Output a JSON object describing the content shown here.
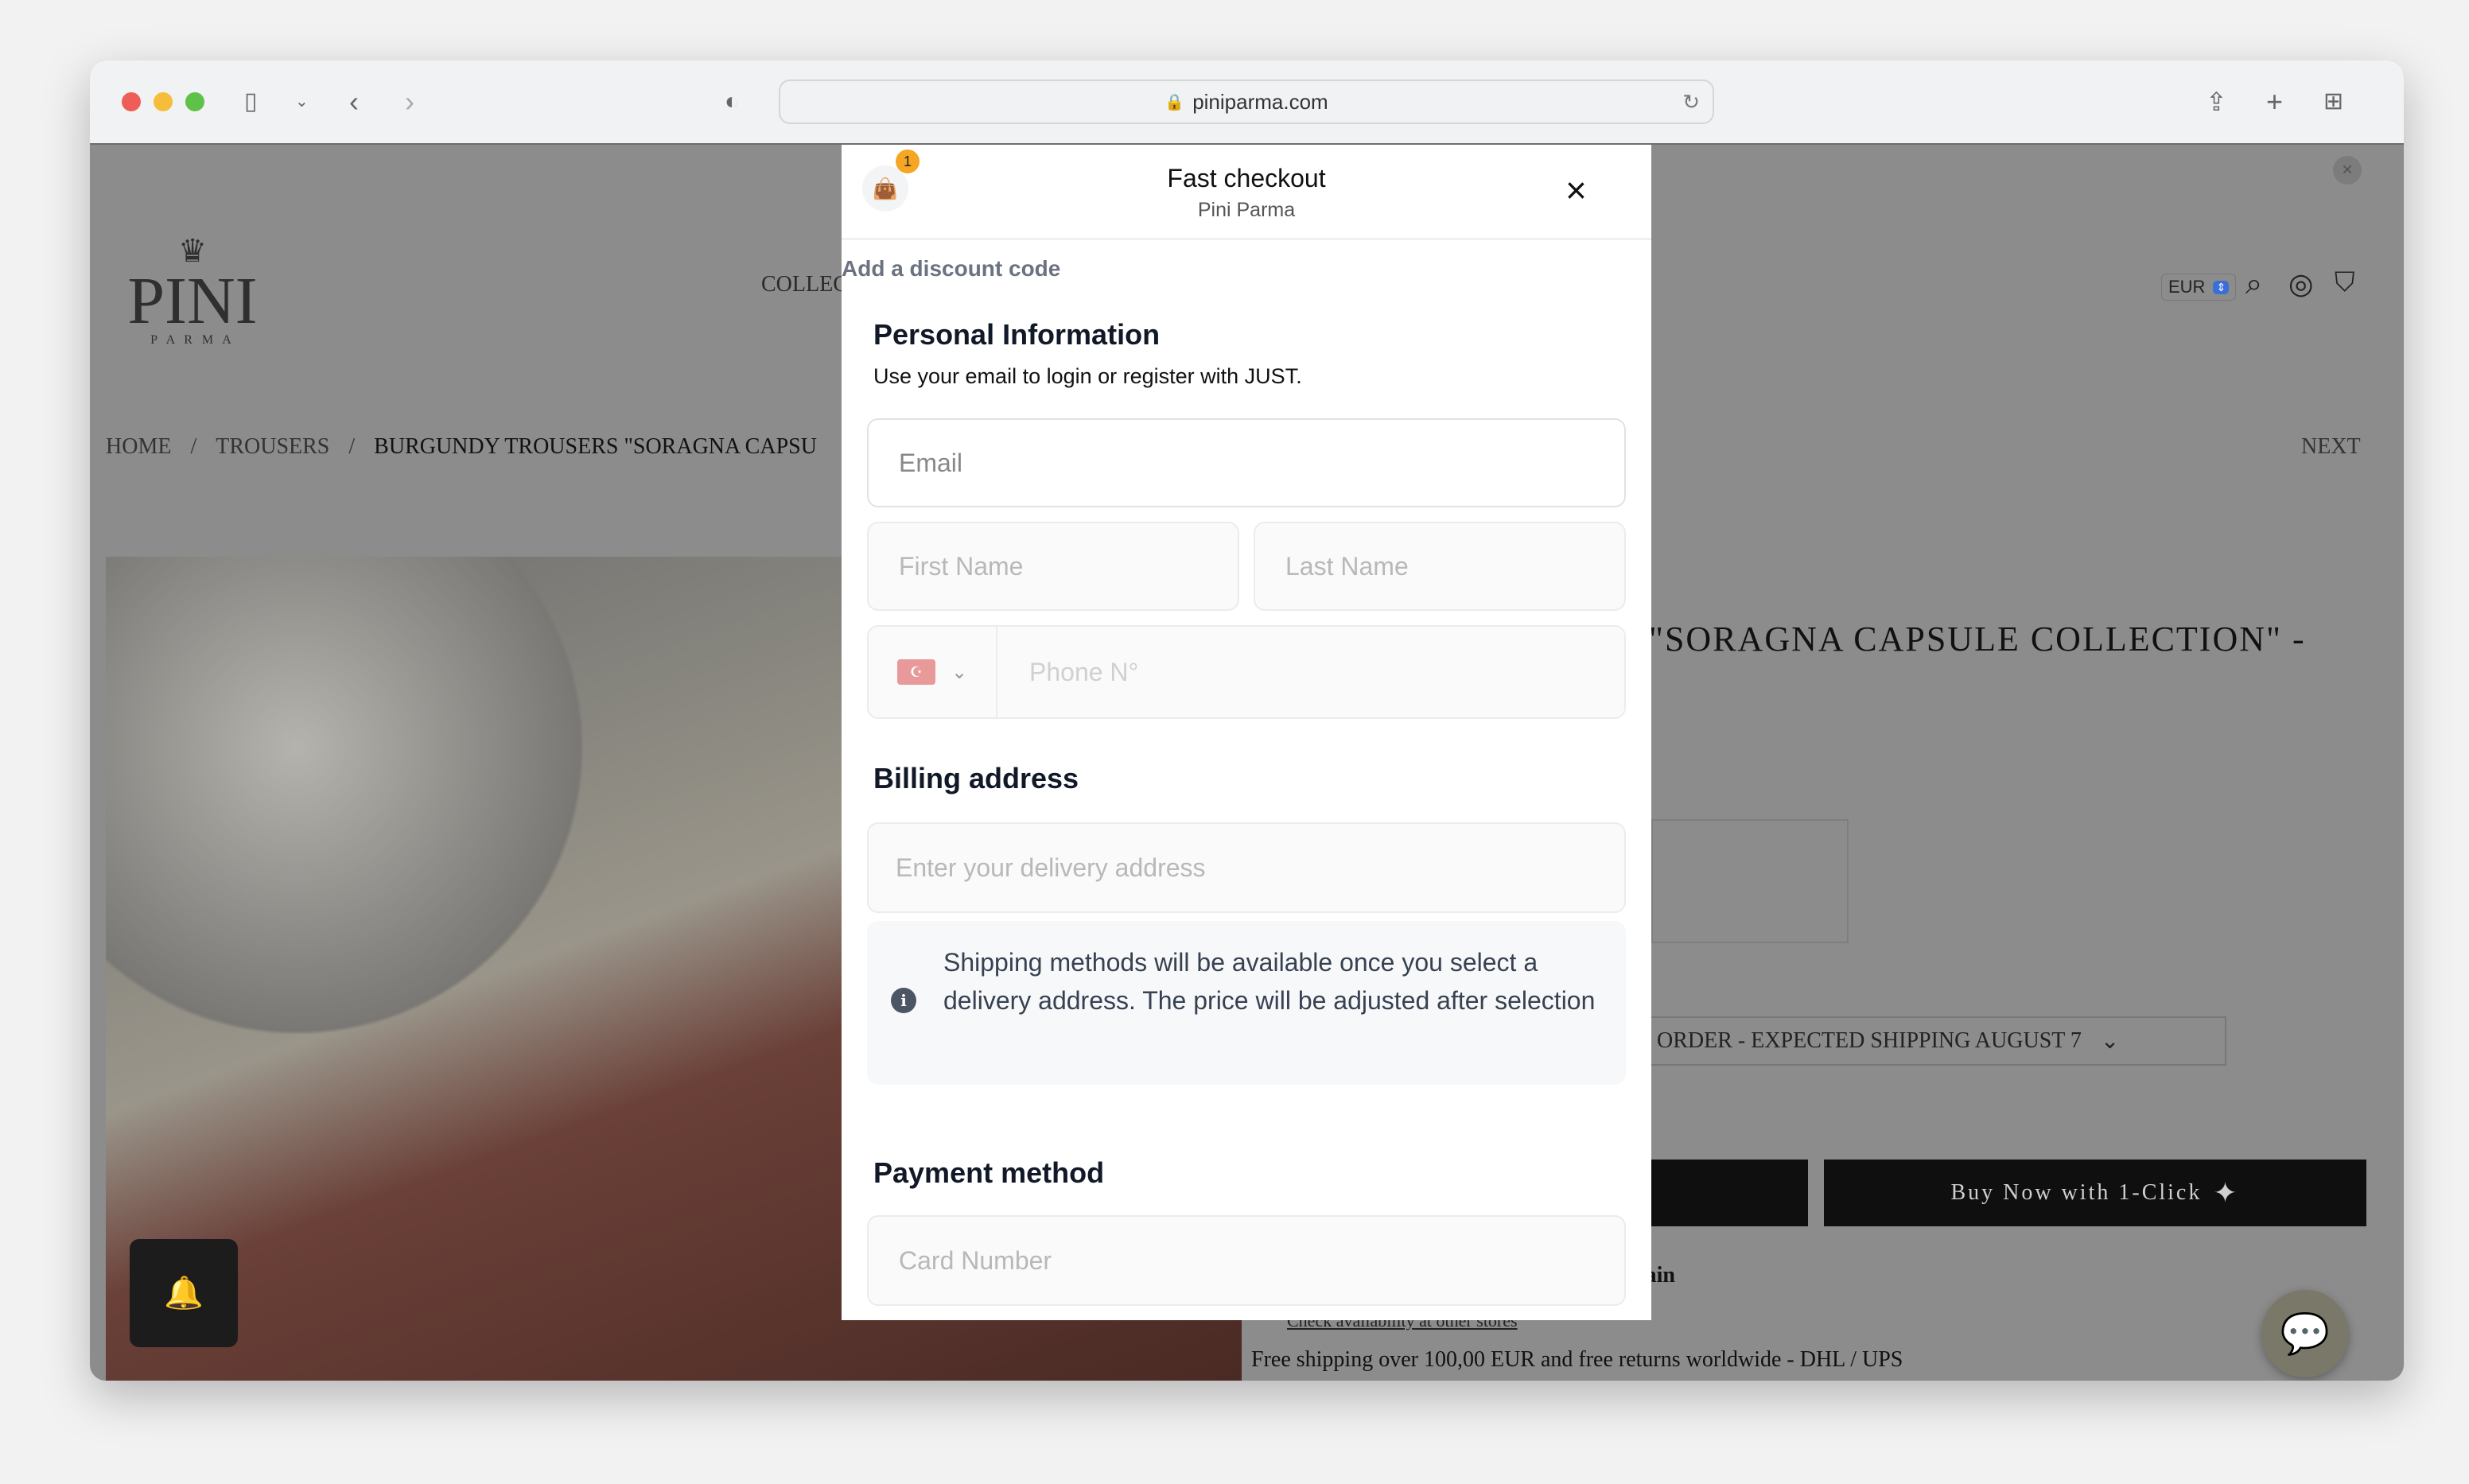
{
  "browser": {
    "url": "piniparma.com"
  },
  "site": {
    "logo": {
      "name": "PINI",
      "sub": "P A R M A"
    },
    "nav_partial": "COLLEC",
    "currency": "EUR",
    "breadcrumb": [
      "HOME",
      "TROUSERS",
      "BURGUNDY TROUSERS \"SORAGNA CAPSU"
    ],
    "next": "NEXT",
    "product_title_partial": "\"SORAGNA CAPSULE COLLECTION\" -",
    "variant_select": "ORDER - EXPECTED SHIPPING AUGUST 7",
    "buy_now": "Buy Now with 1-Click",
    "remain_partial": "nain",
    "availability_link": "Check availability at other stores",
    "shipping_note": "Free shipping over 100,00 EUR and free returns worldwide - DHL / UPS"
  },
  "checkout": {
    "title": "Fast checkout",
    "subtitle": "Pini Parma",
    "cart_badge": "1",
    "discount_link": "Add a discount code",
    "personal": {
      "heading": "Personal Information",
      "desc": "Use your email to login or register with JUST.",
      "email_placeholder": "Email",
      "first_name_placeholder": "First Name",
      "last_name_placeholder": "Last Name",
      "phone_placeholder": "Phone N°"
    },
    "billing": {
      "heading": "Billing address",
      "address_placeholder": "Enter your delivery address",
      "info": "Shipping methods will be available once you select a delivery address. The price will be adjusted after selection"
    },
    "payment": {
      "heading": "Payment method",
      "card_placeholder": "Card Number"
    }
  },
  "colors": {
    "overlay": "#8c8c8c",
    "badge": "#f5a623",
    "link": "#6b7280",
    "button": "#0f0f0f"
  }
}
